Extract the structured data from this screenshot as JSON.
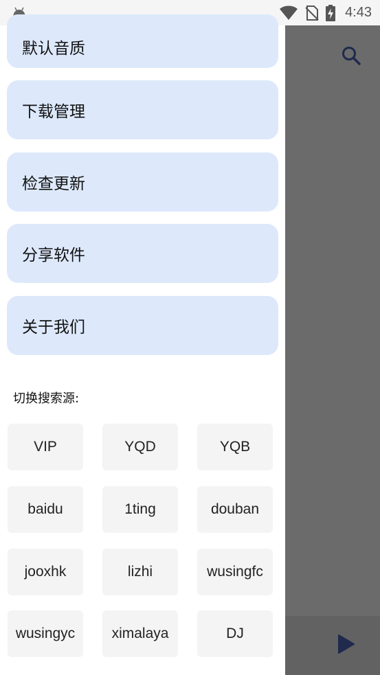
{
  "status_bar": {
    "time": "4:43",
    "icons": [
      "android-icon",
      "wifi-icon",
      "no-sim-icon",
      "battery-charging-icon"
    ]
  },
  "drawer": {
    "menu_items": [
      {
        "label": "默认音质"
      },
      {
        "label": "下载管理"
      },
      {
        "label": "检查更新"
      },
      {
        "label": "分享软件"
      },
      {
        "label": "关于我们"
      }
    ],
    "source_section_label": "切换搜索源:",
    "sources": [
      {
        "label": "VIP"
      },
      {
        "label": "YQD"
      },
      {
        "label": "YQB"
      },
      {
        "label": "baidu"
      },
      {
        "label": "1ting"
      },
      {
        "label": "douban"
      },
      {
        "label": "jooxhk"
      },
      {
        "label": "lizhi"
      },
      {
        "label": "wusingfc"
      },
      {
        "label": "wusingyc"
      },
      {
        "label": "ximalaya"
      },
      {
        "label": "DJ"
      }
    ]
  },
  "background_app": {
    "icons": [
      "search-icon",
      "play-icon"
    ]
  },
  "colors": {
    "menu_card_bg": "#dde9fb",
    "chip_bg": "#f4f4f4",
    "scrim": "#6b6b6b",
    "icon_dark": "#1f2a4d"
  }
}
